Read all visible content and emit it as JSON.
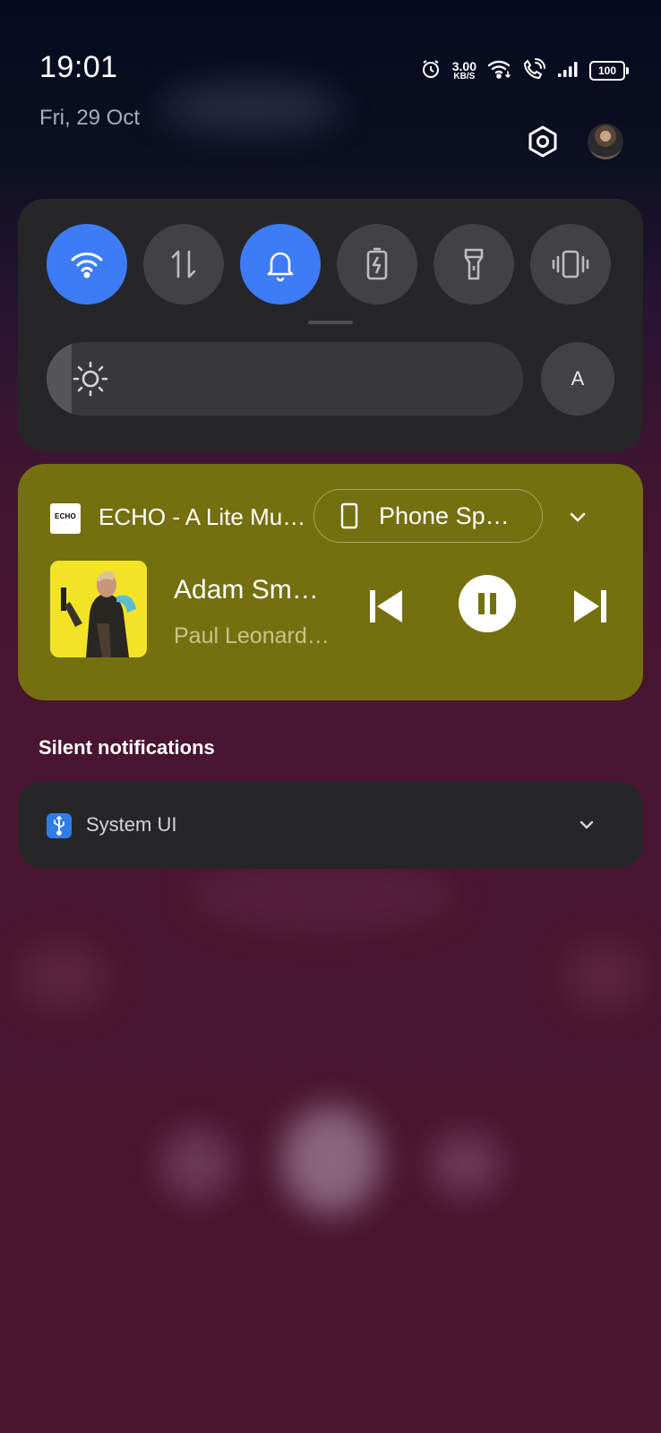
{
  "status_bar": {
    "time": "19:01",
    "date": "Fri, 29 Oct",
    "net_speed_value": "3.00",
    "net_speed_unit": "KB/S",
    "battery": "100",
    "icons": [
      "alarm-icon",
      "wifi-icon",
      "wifi-calling-icon",
      "signal-icon",
      "battery-icon"
    ]
  },
  "header_buttons": [
    "settings-icon",
    "avatar"
  ],
  "quick_settings": {
    "tiles": [
      {
        "name": "wifi",
        "active": true
      },
      {
        "name": "mobile-data",
        "active": false
      },
      {
        "name": "sound",
        "active": true
      },
      {
        "name": "battery-saver",
        "active": false
      },
      {
        "name": "flashlight",
        "active": false
      },
      {
        "name": "vibrate",
        "active": false
      }
    ],
    "brightness": {
      "level": 0.05,
      "auto_label": "A"
    },
    "colors": {
      "active": "#3d7cf6",
      "inactive": "#424246",
      "panel": "#262629"
    }
  },
  "media": {
    "app_name": "ECHO - A Lite Music Player",
    "app_logo_text": "ECHO",
    "output": "Phone Speaker",
    "song": "Adam Smasher",
    "artist": "Paul Leonard-Morgan",
    "state": "playing",
    "accent": "#75700f"
  },
  "silent": {
    "header": "Silent notifications",
    "notifications": [
      {
        "app": "System UI",
        "icon": "usb-icon"
      }
    ]
  }
}
